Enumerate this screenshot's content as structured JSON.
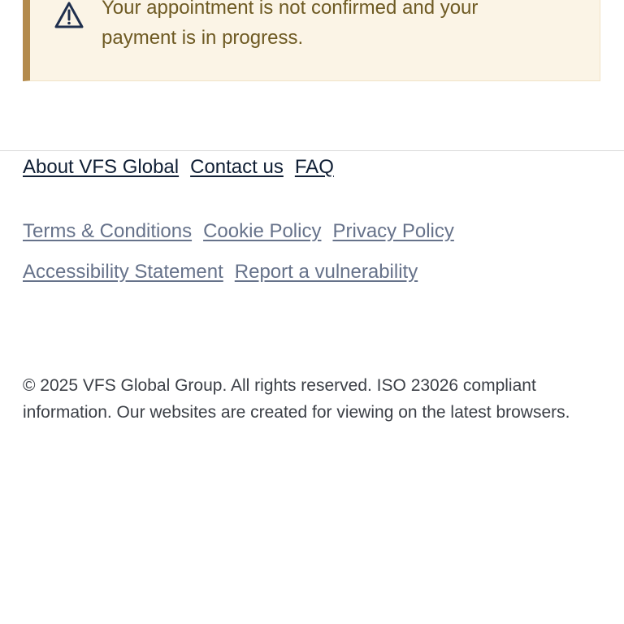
{
  "alert": {
    "icon": "warning-triangle-icon",
    "text": "Your appointment is not confirmed and your payment is in progress.",
    "colors": {
      "background": "#fbf4e6",
      "accent": "#b38a4c",
      "text": "#6e5a23"
    }
  },
  "footer": {
    "primary_links": [
      {
        "label": "About VFS Global"
      },
      {
        "label": "Contact us"
      },
      {
        "label": "FAQ"
      }
    ],
    "secondary_links": [
      {
        "label": "Terms & Conditions"
      },
      {
        "label": "Cookie Policy"
      },
      {
        "label": "Privacy Policy"
      },
      {
        "label": "Accessibility Statement"
      },
      {
        "label": "Report a vulnerability"
      }
    ],
    "copyright": "© 2025 VFS Global Group. All rights reserved. ISO 23026 compliant information. Our websites are created for viewing on the latest browsers."
  }
}
